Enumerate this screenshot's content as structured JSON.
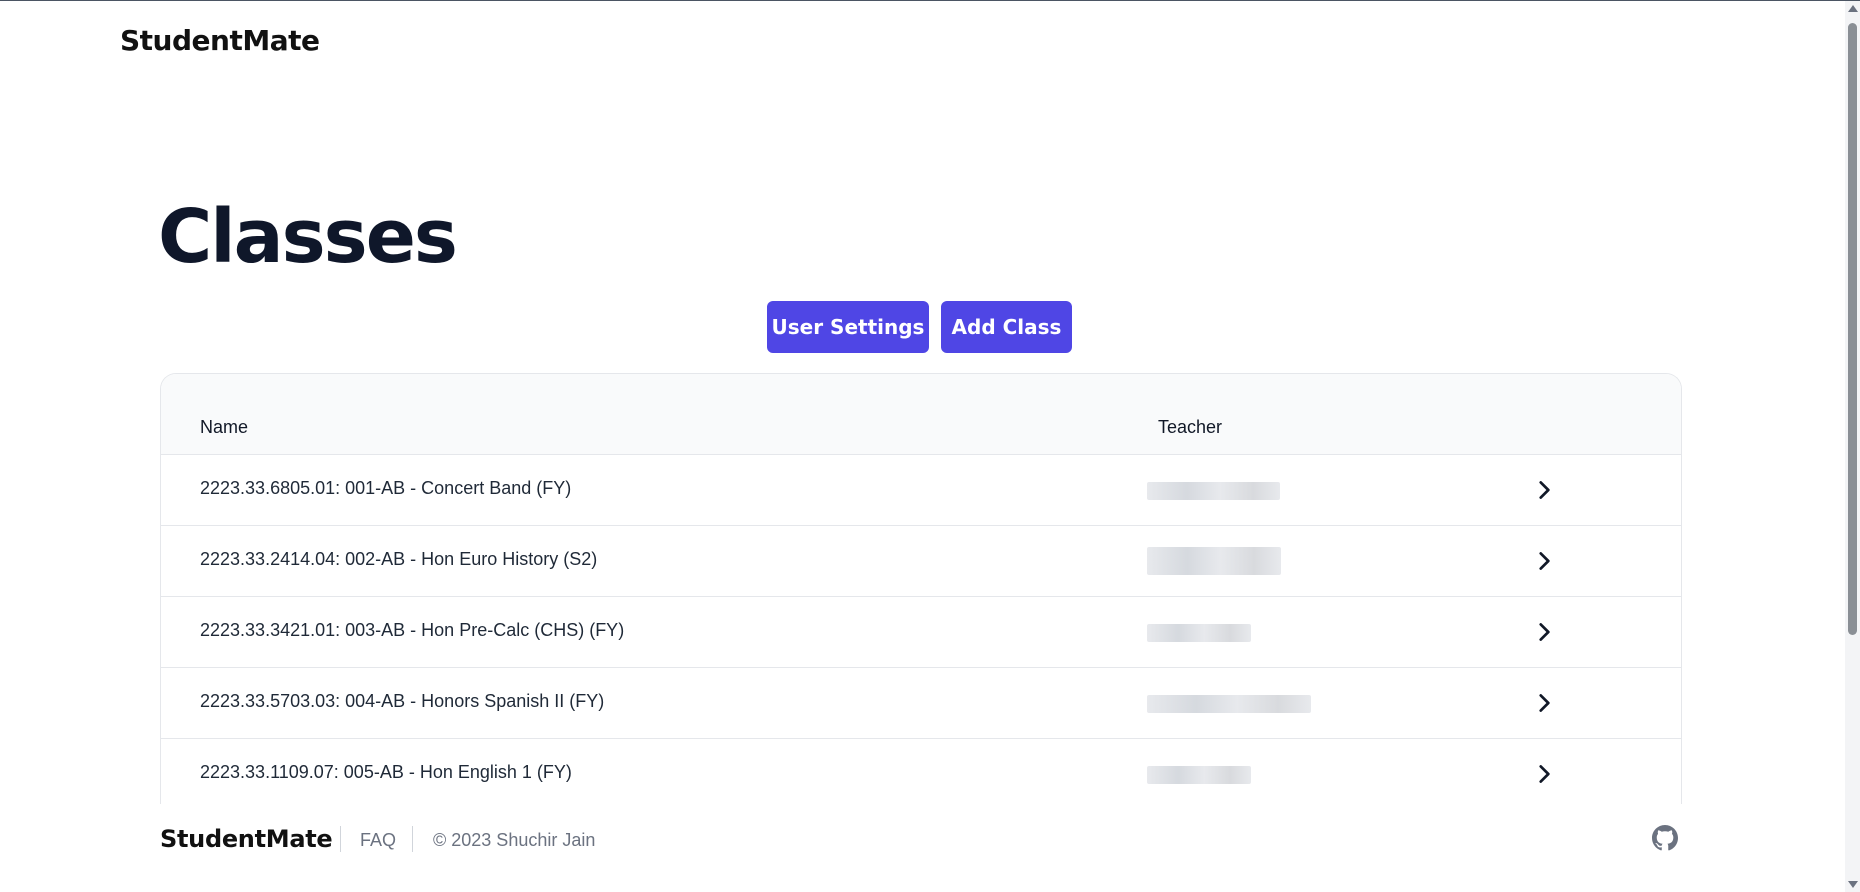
{
  "header": {
    "brand": "StudentMate"
  },
  "page": {
    "title": "Classes"
  },
  "actions": {
    "user_settings_label": "User Settings",
    "add_class_label": "Add Class"
  },
  "table": {
    "columns": {
      "name": "Name",
      "teacher": "Teacher"
    },
    "rows": [
      {
        "name": "2223.33.6805.01: 001-AB - Concert Band (FY)",
        "teacher": "[redacted]"
      },
      {
        "name": "2223.33.2414.04: 002-AB - Hon Euro History (S2)",
        "teacher": "[redacted]"
      },
      {
        "name": "2223.33.3421.01: 003-AB - Hon Pre-Calc (CHS) (FY)",
        "teacher": "[redacted]"
      },
      {
        "name": "2223.33.5703.03: 004-AB - Honors Spanish II (FY)",
        "teacher": "[redacted]"
      },
      {
        "name": "2223.33.1109.07: 005-AB - Hon English 1 (FY)",
        "teacher": "[redacted]"
      }
    ]
  },
  "footer": {
    "brand": "StudentMate",
    "faq": "FAQ",
    "copyright": "© 2023 Shuchir Jain",
    "github_icon": "github-icon"
  },
  "colors": {
    "accent": "#4f46e5",
    "text": "#111827",
    "muted": "#6b7280",
    "border": "#e5e7eb"
  }
}
